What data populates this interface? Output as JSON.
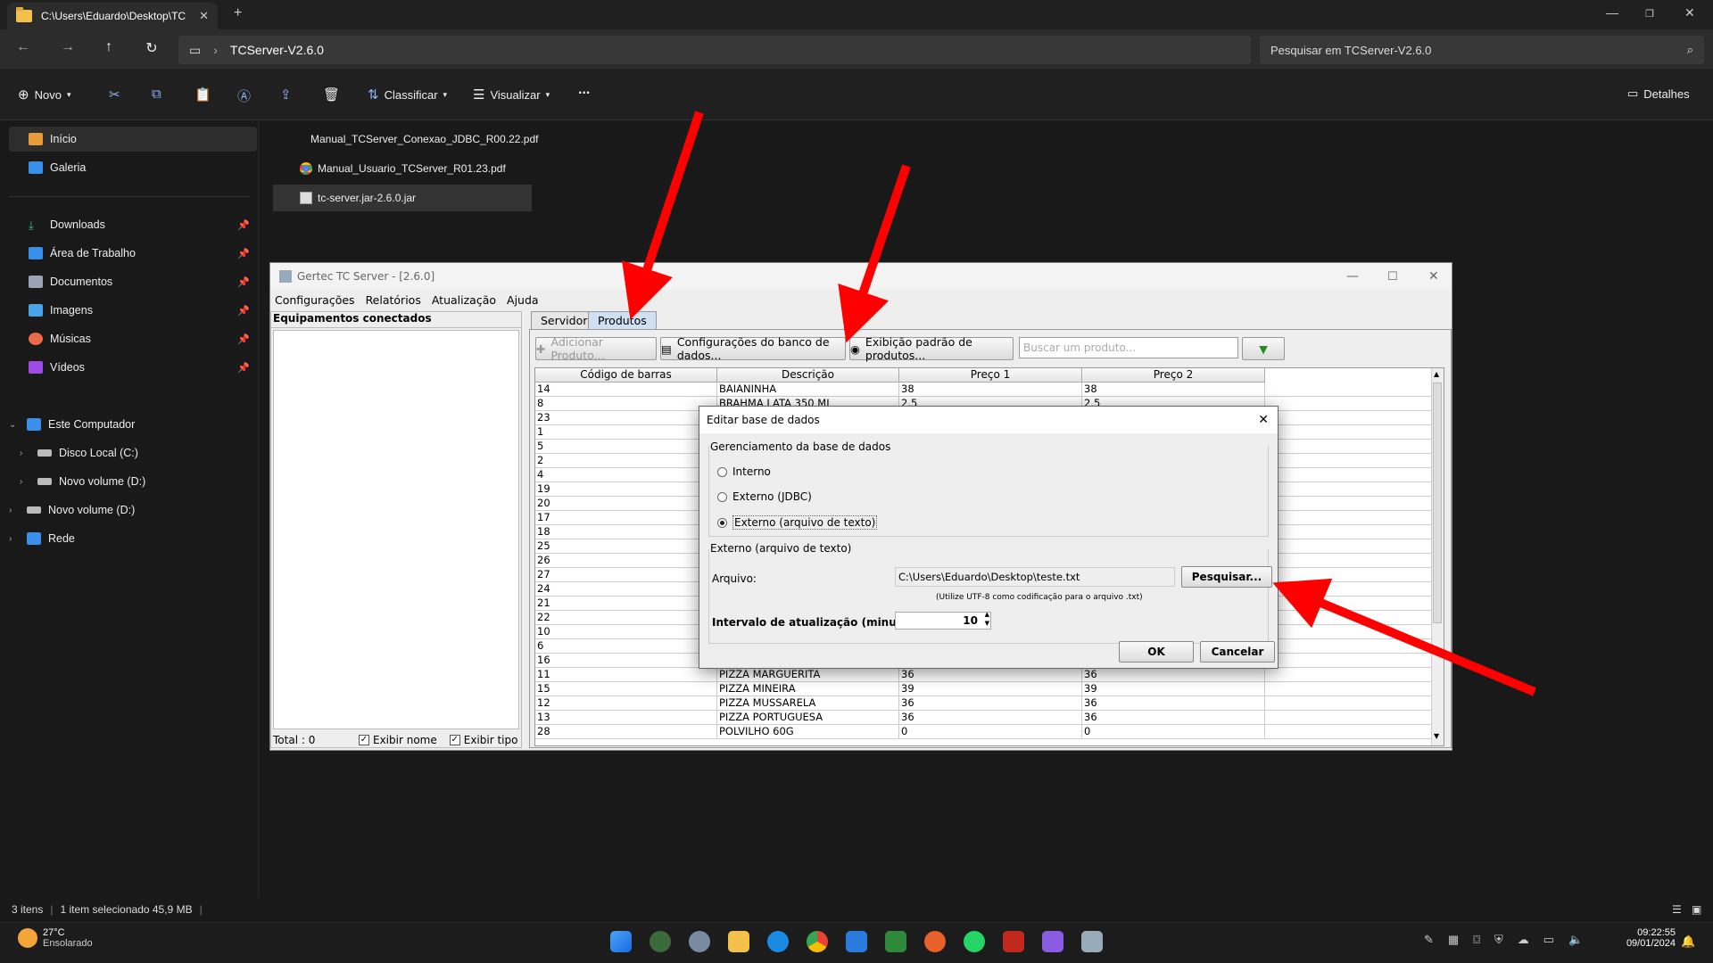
{
  "window": {
    "tab_title": "C:\\Users\\Eduardo\\Desktop\\TC",
    "address": "TCServer-V2.6.0",
    "search_placeholder": "Pesquisar em TCServer-V2.6.0"
  },
  "toolbar": {
    "new": "Novo",
    "sort": "Classificar",
    "view": "Visualizar",
    "more": "...",
    "details": "Detalhes"
  },
  "sidebar": {
    "items": [
      {
        "label": "Início"
      },
      {
        "label": "Galeria"
      },
      {
        "label": "Downloads"
      },
      {
        "label": "Área de Trabalho"
      },
      {
        "label": "Documentos"
      },
      {
        "label": "Imagens"
      },
      {
        "label": "Músicas"
      },
      {
        "label": "Vídeos"
      },
      {
        "label": "Este Computador"
      },
      {
        "label": "Disco Local (C:)"
      },
      {
        "label": "Novo volume (D:)"
      },
      {
        "label": "Novo volume (D:)"
      },
      {
        "label": "Rede"
      }
    ]
  },
  "files": [
    {
      "name": "Manual_TCServer_Conexao_JDBC_R00.22.pdf"
    },
    {
      "name": "Manual_Usuario_TCServer_R01.23.pdf"
    },
    {
      "name": "tc-server.jar-2.6.0.jar"
    }
  ],
  "status": {
    "count": "3 itens",
    "selected": "1 item selecionado  45,9 MB"
  },
  "app": {
    "title": "Gertec TC Server - [2.6.0]",
    "menu": [
      "Configurações",
      "Relatórios",
      "Atualização",
      "Ajuda"
    ],
    "left_header": "Equipamentos conectados",
    "total": "Total : 0",
    "show_name": "Exibir nome",
    "show_type": "Exibir tipo",
    "tabs": [
      "Servidor",
      "Produtos"
    ],
    "btn_add": "Adicionar Produto...",
    "btn_db": "Configurações do banco de dados...",
    "btn_view": "Exibição padrão de produtos...",
    "search_placeholder": "Buscar um produto...",
    "columns": [
      "Código de barras",
      "Descrição",
      "Preço 1",
      "Preço 2"
    ],
    "rows_top": [
      [
        "14",
        "BAIANINHA",
        "38",
        "38"
      ],
      [
        "8",
        "BRAHMA LATA 350 ML",
        "2.5",
        "2.5"
      ]
    ],
    "codes_mid": [
      "23",
      "1",
      "5",
      "2",
      "4",
      "19",
      "20",
      "17",
      "18",
      "25",
      "26",
      "27",
      "24",
      "21",
      "22",
      "10",
      "6",
      "16"
    ],
    "rows_bottom": [
      [
        "11",
        "PIZZA MARGUERITA",
        "36",
        "36"
      ],
      [
        "15",
        "PIZZA MINEIRA",
        "39",
        "39"
      ],
      [
        "12",
        "PIZZA MUSSARELA",
        "36",
        "36"
      ],
      [
        "13",
        "PIZZA PORTUGUESA",
        "36",
        "36"
      ],
      [
        "28",
        "POLVILHO 60G",
        "0",
        "0"
      ]
    ]
  },
  "dialog": {
    "title": "Editar base de dados",
    "group1": "Gerenciamento da base de dados",
    "opt_internal": "Interno",
    "opt_jdbc": "Externo (JDBC)",
    "opt_text": "Externo (arquivo de texto)",
    "group2": "Externo (arquivo de texto)",
    "file_label": "Arquivo:",
    "file_value": "C:\\Users\\Eduardo\\Desktop\\teste.txt",
    "browse": "Pesquisar...",
    "hint": "(Utilize UTF-8 como codificação para o arquivo .txt)",
    "interval_label": "Intervalo de atualização (minutos):",
    "interval_value": "10",
    "ok": "OK",
    "cancel": "Cancelar"
  },
  "taskbar": {
    "temp": "27°C",
    "weather": "Ensolarado",
    "time": "09:22:55",
    "date": "09/01/2024"
  }
}
